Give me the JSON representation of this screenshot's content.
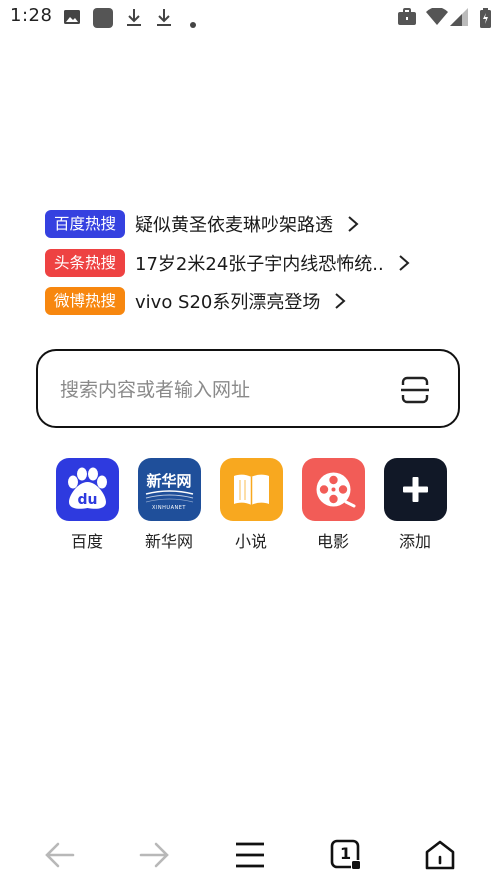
{
  "status_bar": {
    "time": "1:28",
    "left_icons": [
      "image-icon",
      "app-square-icon",
      "download-icon",
      "download-icon",
      "dot-icon"
    ],
    "right_icons": [
      "briefcase-icon",
      "wifi-icon",
      "signal-icon",
      "battery-icon"
    ]
  },
  "hot_searches": [
    {
      "badge": "百度热搜",
      "title": "疑似黄圣依麦琳吵架路透",
      "color": "#3541e0"
    },
    {
      "badge": "头条热搜",
      "title": "17岁2米24张子宇内线恐怖统..",
      "color": "#ee4242"
    },
    {
      "badge": "微博热搜",
      "title": "vivo S20系列漂亮登场",
      "color": "#f7870f"
    }
  ],
  "search": {
    "placeholder": "搜索内容或者输入网址",
    "value": ""
  },
  "quick_links": [
    {
      "label": "百度",
      "icon": "baidu-icon",
      "color": "#2e3adf"
    },
    {
      "label": "新华网",
      "icon": "xinhuanet-icon",
      "color": "#1f4f9a",
      "logo_text": "新华网",
      "logo_sub": "XINHUANET"
    },
    {
      "label": "小说",
      "icon": "book-icon",
      "color": "#f8a81f"
    },
    {
      "label": "电影",
      "icon": "film-reel-icon",
      "color": "#f25c57"
    },
    {
      "label": "添加",
      "icon": "plus-icon",
      "color": "#111827"
    }
  ],
  "bottom_nav": {
    "items": [
      "back-arrow-icon",
      "forward-arrow-icon",
      "menu-icon",
      "tabs-icon",
      "home-icon"
    ],
    "tab_count": "1"
  }
}
